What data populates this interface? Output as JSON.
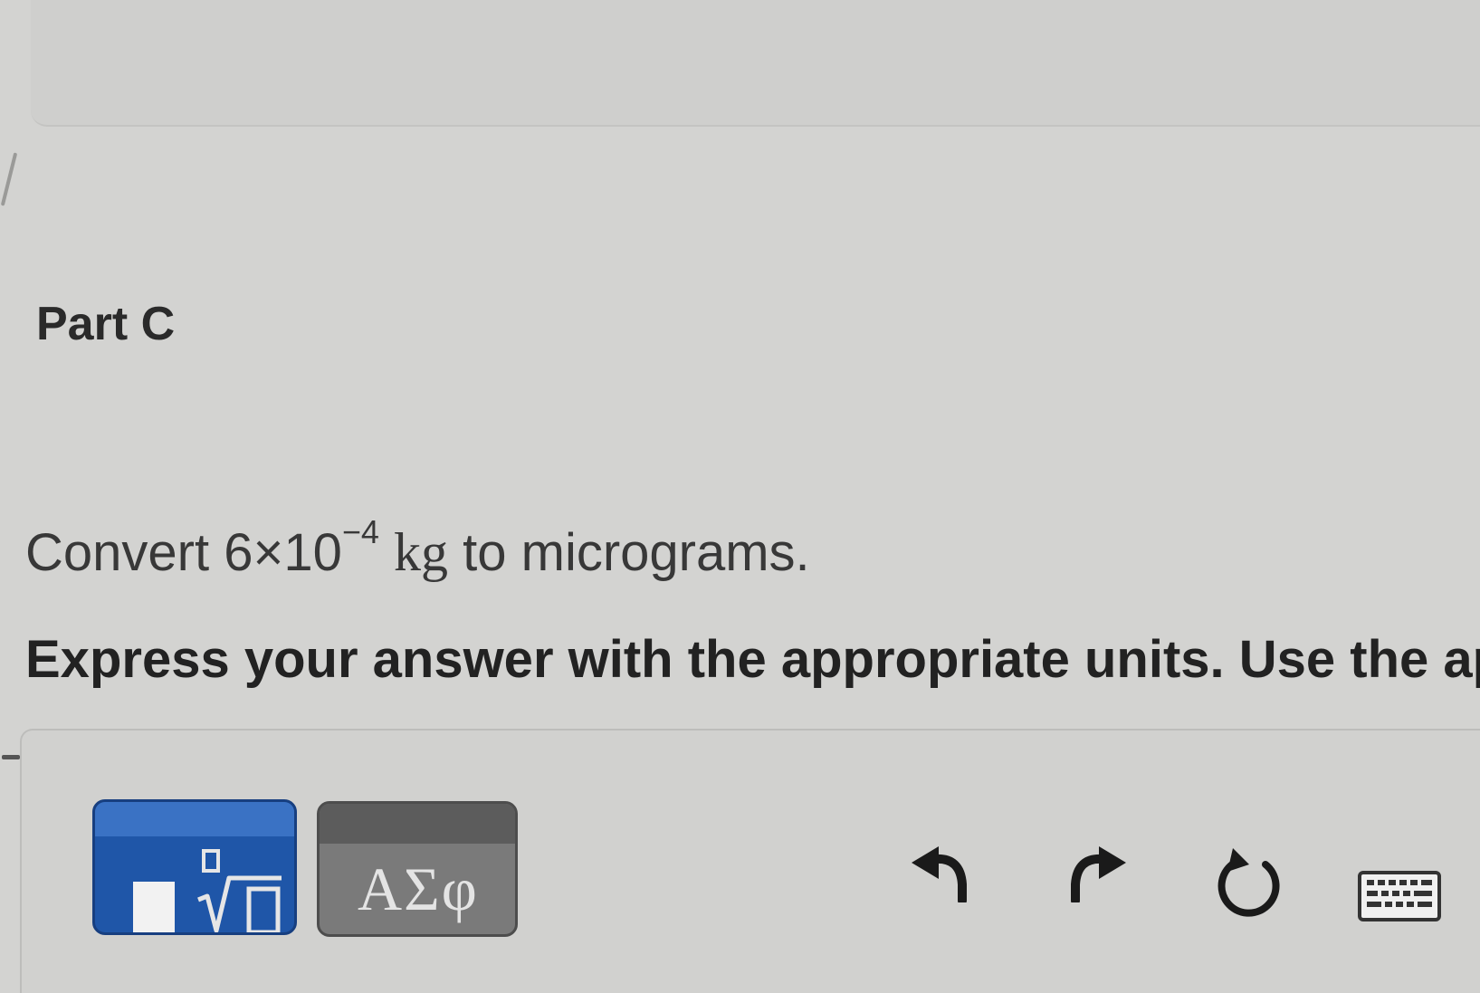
{
  "part": {
    "title": "Part C"
  },
  "question": {
    "prefix": "Convert ",
    "mantissa": "6×10",
    "exponent": "−4",
    "unit": "kg",
    "suffix": " to micrograms."
  },
  "instruction": {
    "text": "Express your answer with the appropriate units. Use the ap"
  },
  "toolbar": {
    "templates_icon": "fraction-root-template-icon",
    "greek_label": "ΑΣφ",
    "undo_icon": "undo-arrow-icon",
    "redo_icon": "redo-arrow-icon",
    "reset_icon": "reset-circular-arrow-icon",
    "keyboard_icon": "keyboard-icon"
  },
  "colors": {
    "templates_button": "#1f56a8",
    "greek_button": "#7a7a7a",
    "background": "#d3d3d1"
  }
}
